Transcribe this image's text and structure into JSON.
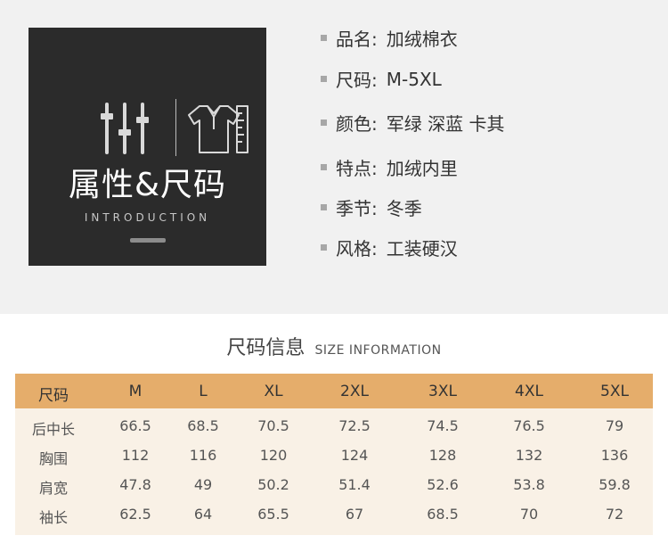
{
  "badge": {
    "title": "属性&尺码",
    "subtitle": "INTRODUCTION"
  },
  "attributes": [
    {
      "label": "品名:",
      "value": "加绒棉衣"
    },
    {
      "label": "尺码:",
      "value": "M-5XL"
    },
    {
      "label": "颜色:",
      "value": "军绿 深蓝 卡其"
    },
    {
      "label": "特点:",
      "value": "加绒内里"
    },
    {
      "label": "季节:",
      "value": "冬季"
    },
    {
      "label": "风格:",
      "value": "工装硬汉"
    }
  ],
  "size_info": {
    "title_cn": "尺码信息",
    "title_en": "SIZE INFORMATION",
    "columns": [
      "尺码",
      "M",
      "L",
      "XL",
      "2XL",
      "3XL",
      "4XL",
      "5XL"
    ],
    "rows": [
      {
        "name": "后中长",
        "values": [
          "66.5",
          "68.5",
          "70.5",
          "72.5",
          "74.5",
          "76.5",
          "79"
        ]
      },
      {
        "name": "胸围",
        "values": [
          "112",
          "116",
          "120",
          "124",
          "128",
          "132",
          "136"
        ]
      },
      {
        "name": "肩宽",
        "values": [
          "47.8",
          "49",
          "50.2",
          "51.4",
          "52.6",
          "53.8",
          "59.8"
        ]
      },
      {
        "name": "袖长",
        "values": [
          "62.5",
          "64",
          "65.5",
          "67",
          "68.5",
          "70",
          "72"
        ]
      }
    ]
  },
  "colors": {
    "top_background": "#f1f1f1",
    "badge_background": "#2b2b2b",
    "table_header": "#e5ad6b",
    "table_body": "#f9f1e6"
  },
  "icons": [
    "sliders-icon",
    "shirt-ruler-icon"
  ]
}
